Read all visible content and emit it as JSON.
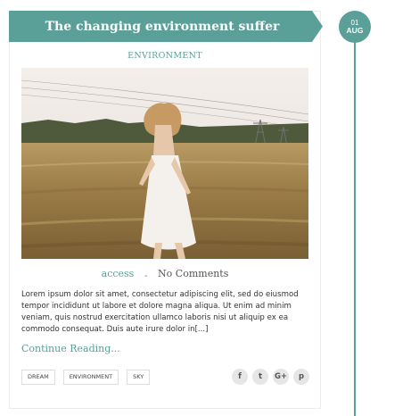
{
  "post": {
    "title": "The changing environment suffer",
    "category": "ENVIRONMENT",
    "author": "access",
    "separator": "-",
    "comments": "No Comments",
    "excerpt": "Lorem ipsum dolor sit amet, consectetur adipiscing elit, sed do eiusmod tempor incididunt ut labore et dolore magna aliqua. Ut enim ad minim veniam, quis nostrud exercitation ullamco laboris nisi ut aliquip ex ea commodo consequat. Duis aute irure dolor in[...]",
    "read_more": "Continue Reading...",
    "tags": [
      "DREAM",
      "ENVIRONMENT",
      "SKY"
    ]
  },
  "date": {
    "day": "01",
    "month": "AUG"
  },
  "share": {
    "facebook": "f",
    "twitter": "t",
    "google_plus": "G+",
    "pinterest": "p"
  },
  "colors": {
    "accent": "#5a9f98",
    "tag_border": "#dedede",
    "share_bg": "#e6e6e6"
  },
  "icons": [
    "facebook-icon",
    "twitter-icon",
    "google-plus-icon",
    "pinterest-icon"
  ]
}
